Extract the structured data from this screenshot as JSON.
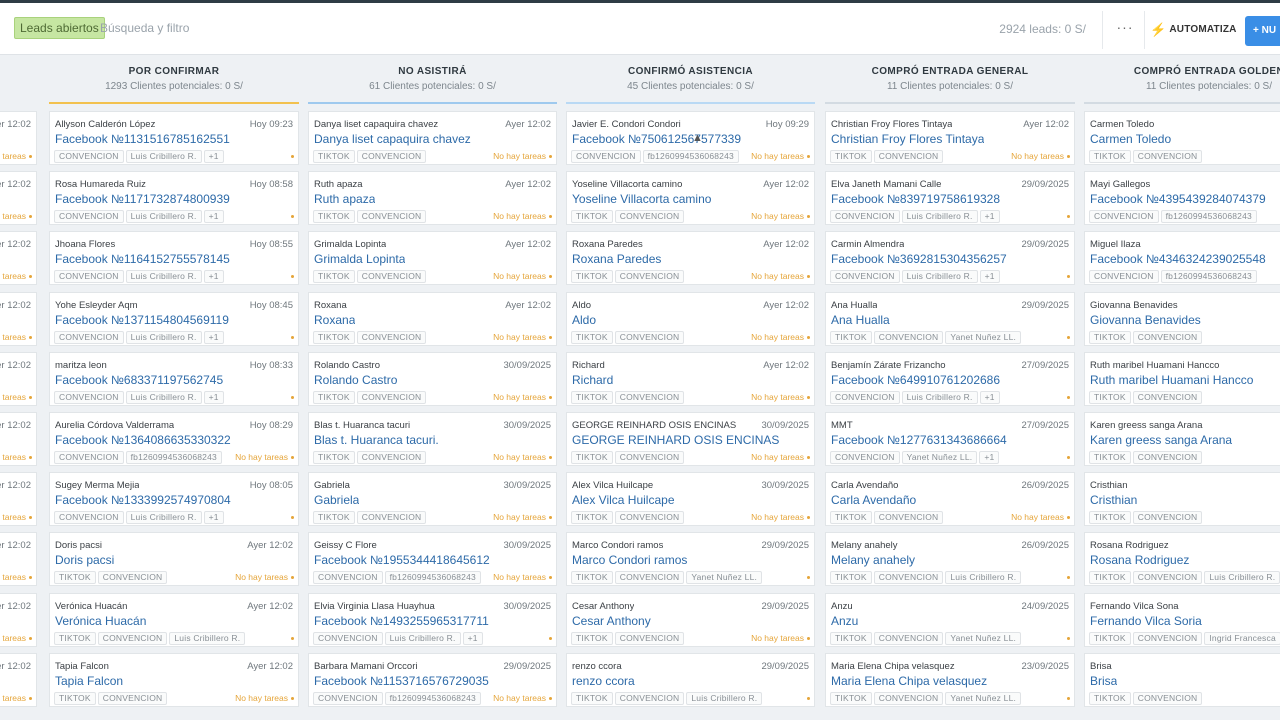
{
  "toolbar": {
    "pipeline_label": "Leads abiertos",
    "search_placeholder": "Búsqueda y filtro",
    "lead_count": "2924 leads: 0 S/",
    "more_label": "···",
    "automate_label": "AUTOMATIZA",
    "new_label": "+ NU"
  },
  "colors": {
    "accent": "#3a8ee6",
    "status": "#e5a53a",
    "link": "#2d6aa8",
    "col_confirm": "#f2c14e",
    "col_no": "#9ec9ee",
    "col_asist": "#b9d9f4",
    "col_general": "#d3dbe2",
    "col_golden": "#d3dbe2"
  },
  "columns": [
    {
      "title": "",
      "subtitle": "",
      "cards": [
        {
          "contact": "",
          "date": "er 12:02",
          "title": "",
          "tags": [],
          "status": "a tareas"
        },
        {
          "contact": "",
          "date": "er 12:02",
          "title": "",
          "tags": [],
          "status": "a tareas"
        },
        {
          "contact": "",
          "date": "er 12:02",
          "title": "",
          "tags": [],
          "status": "a tareas"
        },
        {
          "contact": "",
          "date": "er 12:02",
          "title": "",
          "tags": [],
          "status": "a tareas"
        },
        {
          "contact": "",
          "date": "er 12:02",
          "title": "",
          "tags": [],
          "status": "a tareas"
        },
        {
          "contact": "",
          "date": "er 12:02",
          "title": "",
          "tags": [],
          "status": "a tareas"
        },
        {
          "contact": "",
          "date": "er 12:02",
          "title": "",
          "tags": [],
          "status": "a tareas"
        },
        {
          "contact": "",
          "date": "er 12:02",
          "title": "",
          "tags": [],
          "status": "a tareas"
        },
        {
          "contact": "",
          "date": "er 12:02",
          "title": "",
          "tags": [],
          "status": "a tareas"
        },
        {
          "contact": "",
          "date": "er 12:02",
          "title": "",
          "tags": [],
          "status": "a tareas"
        }
      ]
    },
    {
      "title": "POR CONFIRMAR",
      "subtitle": "1293 Clientes potenciales: 0 S/",
      "cards": [
        {
          "contact": "Allyson Calderón López",
          "date": "Hoy 09:23",
          "title": "Facebook №1131516785162551",
          "tags": [
            "CONVENCION",
            "Luis Cribillero R.",
            "+1"
          ],
          "status": ""
        },
        {
          "contact": "Rosa Humareda Ruiz",
          "date": "Hoy 08:58",
          "title": "Facebook №1171732874800939",
          "tags": [
            "CONVENCION",
            "Luis Cribillero R.",
            "+1"
          ],
          "status": ""
        },
        {
          "contact": "Jhoana Flores",
          "date": "Hoy 08:55",
          "title": "Facebook №1164152755578145",
          "tags": [
            "CONVENCION",
            "Luis Cribillero R.",
            "+1"
          ],
          "status": ""
        },
        {
          "contact": "Yohe Esleyder Aqm",
          "date": "Hoy 08:45",
          "title": "Facebook №1371154804569119",
          "tags": [
            "CONVENCION",
            "Luis Cribillero R.",
            "+1"
          ],
          "status": ""
        },
        {
          "contact": "maritza leon",
          "date": "Hoy 08:33",
          "title": "Facebook №683371197562745",
          "tags": [
            "CONVENCION",
            "Luis Cribillero R.",
            "+1"
          ],
          "status": ""
        },
        {
          "contact": "Aurelia Córdova Valderrama",
          "date": "Hoy 08:29",
          "title": "Facebook №1364086635330322",
          "tags": [
            "CONVENCION",
            "fb1260994536068243"
          ],
          "status": "No hay tareas"
        },
        {
          "contact": "Sugey Merma Mejia",
          "date": "Hoy 08:05",
          "title": "Facebook №1333992574970804",
          "tags": [
            "CONVENCION",
            "Luis Cribillero R.",
            "+1"
          ],
          "status": ""
        },
        {
          "contact": "Doris pacsi",
          "date": "Ayer 12:02",
          "title": "Doris pacsi",
          "tags": [
            "TIKTOK",
            "CONVENCION"
          ],
          "status": "No hay tareas"
        },
        {
          "contact": "Verónica Huacán",
          "date": "Ayer 12:02",
          "title": "Verónica Huacán",
          "tags": [
            "TIKTOK",
            "CONVENCION",
            "Luis Cribillero R."
          ],
          "status": ""
        },
        {
          "contact": "Tapia Falcon",
          "date": "Ayer 12:02",
          "title": "Tapia Falcon",
          "tags": [
            "TIKTOK",
            "CONVENCION"
          ],
          "status": "No hay tareas"
        }
      ]
    },
    {
      "title": "NO ASISTIRÁ",
      "subtitle": "61 Clientes potenciales: 0 S/",
      "cards": [
        {
          "contact": "Danya liset capaquira chavez",
          "date": "Ayer 12:02",
          "title": "Danya liset capaquira chavez",
          "tags": [
            "TIKTOK",
            "CONVENCION"
          ],
          "status": "No hay tareas"
        },
        {
          "contact": "Ruth apaza",
          "date": "Ayer 12:02",
          "title": "Ruth apaza",
          "tags": [
            "TIKTOK",
            "CONVENCION"
          ],
          "status": "No hay tareas"
        },
        {
          "contact": "Grimalda Lopinta",
          "date": "Ayer 12:02",
          "title": "Grimalda Lopinta",
          "tags": [
            "TIKTOK",
            "CONVENCION"
          ],
          "status": "No hay tareas"
        },
        {
          "contact": "Roxana",
          "date": "Ayer 12:02",
          "title": "Roxana",
          "tags": [
            "TIKTOK",
            "CONVENCION"
          ],
          "status": "No hay tareas"
        },
        {
          "contact": "Rolando Castro",
          "date": "30/09/2025",
          "title": "Rolando Castro",
          "tags": [
            "TIKTOK",
            "CONVENCION"
          ],
          "status": "No hay tareas"
        },
        {
          "contact": "Blas t. Huaranca tacuri",
          "date": "30/09/2025",
          "title": "Blas t. Huaranca tacuri.",
          "tags": [
            "TIKTOK",
            "CONVENCION"
          ],
          "status": "No hay tareas"
        },
        {
          "contact": "Gabriela",
          "date": "30/09/2025",
          "title": "Gabriela",
          "tags": [
            "TIKTOK",
            "CONVENCION"
          ],
          "status": "No hay tareas"
        },
        {
          "contact": "Geissy C Flore",
          "date": "30/09/2025",
          "title": "Facebook №1955344418645612",
          "tags": [
            "CONVENCION",
            "fb1260994536068243"
          ],
          "status": "No hay tareas"
        },
        {
          "contact": "Elvia Virginia Llasa Huayhua",
          "date": "30/09/2025",
          "title": "Facebook №1493255965317711",
          "tags": [
            "CONVENCION",
            "Luis Cribillero R.",
            "+1"
          ],
          "status": ""
        },
        {
          "contact": "Barbara Mamani Orccori",
          "date": "29/09/2025",
          "title": "Facebook №1153716576729035",
          "tags": [
            "CONVENCION",
            "fb1260994536068243"
          ],
          "status": "No hay tareas"
        }
      ]
    },
    {
      "title": "CONFIRMÓ ASISTENCIA",
      "subtitle": "45 Clientes potenciales: 0 S/",
      "cards": [
        {
          "contact": "Javier E. Condori Condori",
          "date": "Hoy 09:29",
          "title": "Facebook №750612567577339",
          "tags": [
            "CONVENCION",
            "fb1260994536068243"
          ],
          "status": "No hay tareas"
        },
        {
          "contact": "Yoseline Villacorta camino",
          "date": "Ayer 12:02",
          "title": "Yoseline Villacorta camino",
          "tags": [
            "TIKTOK",
            "CONVENCION"
          ],
          "status": "No hay tareas"
        },
        {
          "contact": "Roxana Paredes",
          "date": "Ayer 12:02",
          "title": "Roxana Paredes",
          "tags": [
            "TIKTOK",
            "CONVENCION"
          ],
          "status": "No hay tareas"
        },
        {
          "contact": "Aldo",
          "date": "Ayer 12:02",
          "title": "Aldo",
          "tags": [
            "TIKTOK",
            "CONVENCION"
          ],
          "status": "No hay tareas"
        },
        {
          "contact": "Richard",
          "date": "Ayer 12:02",
          "title": "Richard",
          "tags": [
            "TIKTOK",
            "CONVENCION"
          ],
          "status": "No hay tareas"
        },
        {
          "contact": "GEORGE REINHARD OSIS ENCINAS",
          "date": "30/09/2025",
          "title": "GEORGE REINHARD OSIS ENCINAS",
          "tags": [
            "TIKTOK",
            "CONVENCION"
          ],
          "status": "No hay tareas"
        },
        {
          "contact": "Alex Vilca Huilcape",
          "date": "30/09/2025",
          "title": "Alex Vilca Huilcape",
          "tags": [
            "TIKTOK",
            "CONVENCION"
          ],
          "status": "No hay tareas"
        },
        {
          "contact": "Marco Condori ramos",
          "date": "29/09/2025",
          "title": "Marco Condori ramos",
          "tags": [
            "TIKTOK",
            "CONVENCION",
            "Yanet Nuñez LL."
          ],
          "status": ""
        },
        {
          "contact": "Cesar Anthony",
          "date": "29/09/2025",
          "title": "Cesar Anthony",
          "tags": [
            "TIKTOK",
            "CONVENCION"
          ],
          "status": "No hay tareas"
        },
        {
          "contact": "renzo ccora",
          "date": "29/09/2025",
          "title": "renzo ccora",
          "tags": [
            "TIKTOK",
            "CONVENCION",
            "Luis Cribillero R."
          ],
          "status": ""
        }
      ]
    },
    {
      "title": "COMPRÓ ENTRADA GENERAL",
      "subtitle": "11 Clientes potenciales: 0 S/",
      "cards": [
        {
          "contact": "Christian Froy Flores Tintaya",
          "date": "Ayer 12:02",
          "title": "Christian Froy Flores Tintaya",
          "tags": [
            "TIKTOK",
            "CONVENCION"
          ],
          "status": "No hay tareas"
        },
        {
          "contact": "Elva Janeth Mamani Calle",
          "date": "29/09/2025",
          "title": "Facebook №839719758619328",
          "tags": [
            "CONVENCION",
            "Luis Cribillero R.",
            "+1"
          ],
          "status": ""
        },
        {
          "contact": "Carmin Almendra",
          "date": "29/09/2025",
          "title": "Facebook №3692815304356257",
          "tags": [
            "CONVENCION",
            "Luis Cribillero R.",
            "+1"
          ],
          "status": ""
        },
        {
          "contact": "Ana Hualla",
          "date": "29/09/2025",
          "title": "Ana Hualla",
          "tags": [
            "TIKTOK",
            "CONVENCION",
            "Yanet Nuñez LL."
          ],
          "status": ""
        },
        {
          "contact": "Benjamín Zárate Frizancho",
          "date": "27/09/2025",
          "title": "Facebook №649910761202686",
          "tags": [
            "CONVENCION",
            "Luis Cribillero R.",
            "+1"
          ],
          "status": ""
        },
        {
          "contact": "MMT",
          "date": "27/09/2025",
          "title": "Facebook №1277631343686664",
          "tags": [
            "CONVENCION",
            "Yanet Nuñez LL.",
            "+1"
          ],
          "status": ""
        },
        {
          "contact": "Carla Avendaño",
          "date": "26/09/2025",
          "title": "Carla Avendaño",
          "tags": [
            "TIKTOK",
            "CONVENCION"
          ],
          "status": "No hay tareas"
        },
        {
          "contact": "Melany anahely",
          "date": "26/09/2025",
          "title": "Melany anahely",
          "tags": [
            "TIKTOK",
            "CONVENCION",
            "Luis Cribillero R."
          ],
          "status": ""
        },
        {
          "contact": "Anzu",
          "date": "24/09/2025",
          "title": "Anzu",
          "tags": [
            "TIKTOK",
            "CONVENCION",
            "Yanet Nuñez LL."
          ],
          "status": ""
        },
        {
          "contact": "Maria Elena Chipa velasquez",
          "date": "23/09/2025",
          "title": "Maria Elena Chipa velasquez",
          "tags": [
            "TIKTOK",
            "CONVENCION",
            "Yanet Nuñez LL."
          ],
          "status": ""
        }
      ]
    },
    {
      "title": "COMPRÓ ENTRADA GOLDEN",
      "subtitle": "11 Clientes potenciales: 0 S/",
      "cards": [
        {
          "contact": "Carmen Toledo",
          "date": "",
          "title": "Carmen Toledo",
          "tags": [
            "TIKTOK",
            "CONVENCION"
          ],
          "status": "No"
        },
        {
          "contact": "Mayi Gallegos",
          "date": "",
          "title": "Facebook №4395439284074379",
          "tags": [
            "CONVENCION",
            "fb1260994536068243"
          ],
          "status": ""
        },
        {
          "contact": "Miguel Ilaza",
          "date": "",
          "title": "Facebook №4346324239025548",
          "tags": [
            "CONVENCION",
            "fb1260994536068243"
          ],
          "status": ""
        },
        {
          "contact": "Giovanna Benavides",
          "date": "",
          "title": "Giovanna Benavides",
          "tags": [
            "TIKTOK",
            "CONVENCION"
          ],
          "status": "No"
        },
        {
          "contact": "Ruth maribel Huamani Hancco",
          "date": "",
          "title": "Ruth maribel Huamani Hancco",
          "tags": [
            "TIKTOK",
            "CONVENCION"
          ],
          "status": "No"
        },
        {
          "contact": "Karen greess sanga Arana",
          "date": "",
          "title": "Karen greess sanga Arana",
          "tags": [
            "TIKTOK",
            "CONVENCION"
          ],
          "status": "No"
        },
        {
          "contact": "Cristhian",
          "date": "",
          "title": "Cristhian",
          "tags": [
            "TIKTOK",
            "CONVENCION"
          ],
          "status": "No"
        },
        {
          "contact": "Rosana Rodriguez",
          "date": "",
          "title": "Rosana Rodriguez",
          "tags": [
            "TIKTOK",
            "CONVENCION",
            "Luis Cribillero R."
          ],
          "status": ""
        },
        {
          "contact": "Fernando Vilca Sona",
          "date": "",
          "title": "Fernando Vilca Soria",
          "tags": [
            "TIKTOK",
            "CONVENCION",
            "Ingrid Francesca"
          ],
          "status": ""
        },
        {
          "contact": "Brisa",
          "date": "",
          "title": "Brisa",
          "tags": [
            "TIKTOK",
            "CONVENCION"
          ],
          "status": "No"
        }
      ]
    }
  ]
}
